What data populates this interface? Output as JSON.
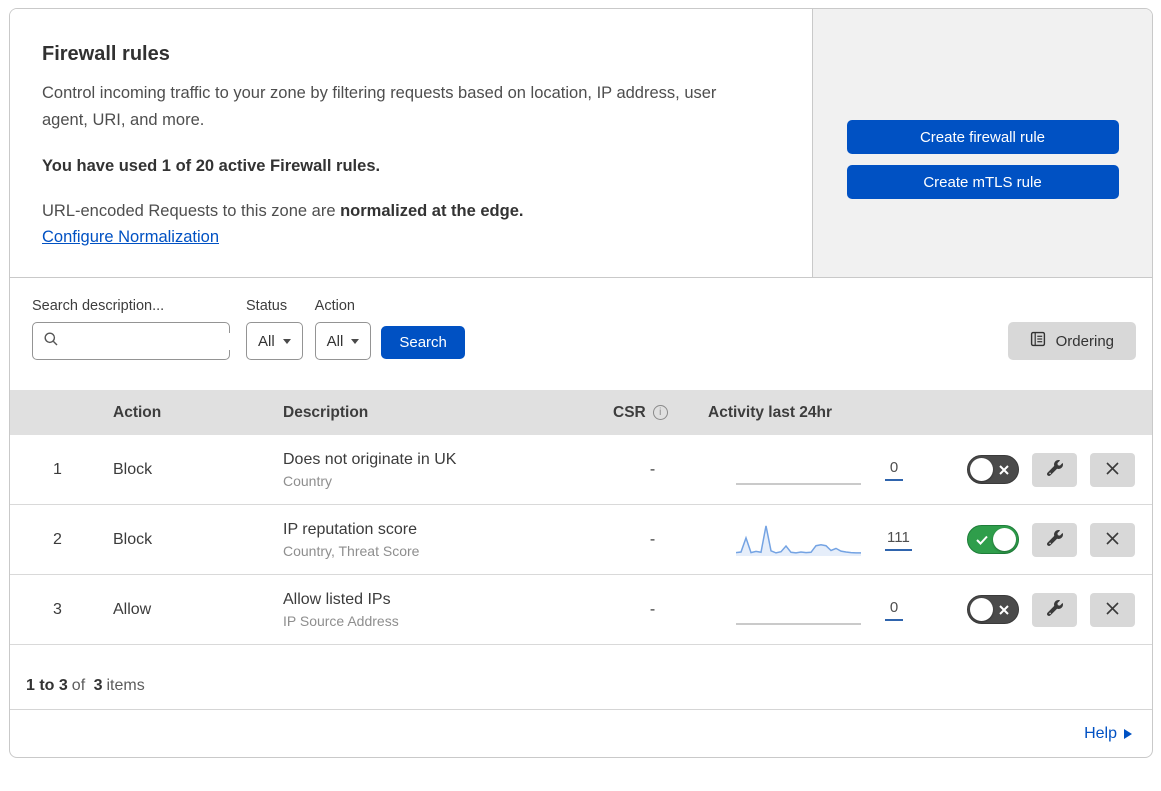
{
  "page": {
    "title": "Firewall rules",
    "description": "Control incoming traffic to your zone by filtering requests based on location, IP address, user agent, URI, and more.",
    "usage_note": "You have used 1 of 20 active Firewall rules.",
    "normalization_text": "URL-encoded Requests to this zone are ",
    "normalization_bold": "normalized at the edge.",
    "normalization_link": "Configure Normalization"
  },
  "actions_panel": {
    "create_firewall_label": "Create firewall rule",
    "create_mtls_label": "Create mTLS rule"
  },
  "filters": {
    "search_label": "Search description...",
    "status_label": "Status",
    "status_value": "All",
    "action_label": "Action",
    "action_value": "All",
    "search_button_label": "Search",
    "ordering_button_label": "Ordering"
  },
  "table": {
    "headers": {
      "action": "Action",
      "description": "Description",
      "csr": "CSR",
      "activity": "Activity last 24hr"
    },
    "rows": [
      {
        "priority": "1",
        "action": "Block",
        "description": "Does not originate in UK",
        "criteria": "Country",
        "csr": "-",
        "activity_count": "0",
        "enabled": false,
        "sparkline_values": []
      },
      {
        "priority": "2",
        "action": "Block",
        "description": "IP reputation score",
        "criteria": "Country, Threat Score",
        "csr": "-",
        "activity_count": "111",
        "enabled": true,
        "sparkline_values": [
          8,
          10,
          57,
          8,
          12,
          9,
          97,
          14,
          7,
          11,
          30,
          9,
          7,
          10,
          8,
          9,
          31,
          34,
          31,
          15,
          22,
          13,
          10,
          8,
          7,
          7
        ]
      },
      {
        "priority": "3",
        "action": "Allow",
        "description": "Allow listed IPs",
        "criteria": "IP Source Address",
        "csr": "-",
        "activity_count": "0",
        "enabled": false,
        "sparkline_values": []
      }
    ]
  },
  "footer": {
    "range": "1 to 3",
    "of_label": "of",
    "total": "3",
    "items_label": "items",
    "help_label": "Help"
  },
  "icons": {
    "info_glyph": "i"
  },
  "colors": {
    "accent_blue": "#0051c3",
    "toggle_on_green": "#2f9e4b",
    "toggle_off_gray": "#4a4a4a",
    "sparkline_blue": "#74a3e3",
    "count_underline_blue": "#2f64ad"
  }
}
